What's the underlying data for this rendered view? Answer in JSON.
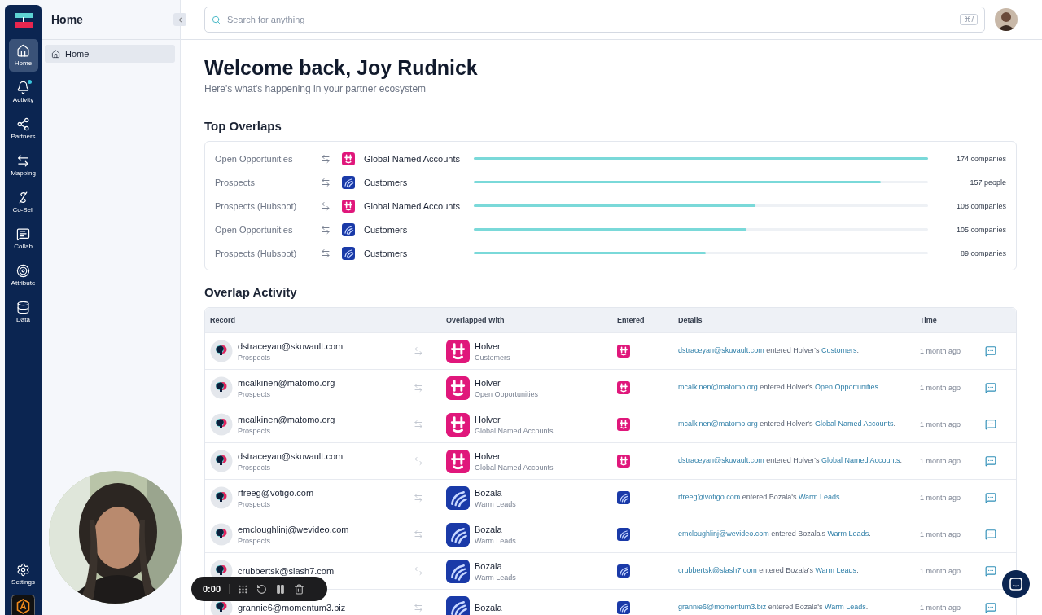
{
  "rail": {
    "items": [
      {
        "label": "Home",
        "kind": "home",
        "selected": true,
        "unread": false
      },
      {
        "label": "Activity",
        "kind": "bell",
        "selected": false,
        "unread": true
      },
      {
        "label": "Partners",
        "kind": "partners",
        "selected": false,
        "unread": false
      },
      {
        "label": "Mapping",
        "kind": "mapping",
        "selected": false,
        "unread": false
      },
      {
        "label": "Co-Sell",
        "kind": "cosell",
        "selected": false,
        "unread": false
      },
      {
        "label": "Collab",
        "kind": "collab",
        "selected": false,
        "unread": false
      },
      {
        "label": "Attribute",
        "kind": "attribute",
        "selected": false,
        "unread": false
      },
      {
        "label": "Data",
        "kind": "data",
        "selected": false,
        "unread": false
      }
    ],
    "bottom": {
      "label": "Settings"
    }
  },
  "sidebar": {
    "title": "Home",
    "items": [
      {
        "label": "Home",
        "selected": true
      }
    ]
  },
  "search": {
    "placeholder": "Search for anything",
    "shortcut": "⌘/"
  },
  "welcome": {
    "title": "Welcome back, Joy Rudnick",
    "subtitle": "Here's what's happening in your partner ecosystem"
  },
  "top_overlaps": {
    "title": "Top Overlaps",
    "rows": [
      {
        "source": "Open Opportunities",
        "kind": "holver",
        "target": "Global Named Accounts",
        "level": 1.0,
        "count": "174 companies"
      },
      {
        "source": "Prospects",
        "kind": "bozala",
        "target": "Customers",
        "level": 0.896,
        "count": "157 people"
      },
      {
        "source": "Prospects (Hubspot)",
        "kind": "holver",
        "target": "Global Named Accounts",
        "level": 0.62,
        "count": "108 companies"
      },
      {
        "source": "Open Opportunities",
        "kind": "bozala",
        "target": "Customers",
        "level": 0.6,
        "count": "105 companies"
      },
      {
        "source": "Prospects (Hubspot)",
        "kind": "bozala",
        "target": "Customers",
        "level": 0.51,
        "count": "89 companies"
      }
    ]
  },
  "overlap_activity": {
    "title": "Overlap Activity",
    "columns": [
      "Record",
      "Overlapped With",
      "Entered",
      "Details",
      "Time"
    ],
    "rows": [
      {
        "record": "dstraceyan@skuvault.com",
        "record_list": "Prospects",
        "kind": "holver",
        "partner": "Holver",
        "partner_list": "Customers",
        "details": {
          "who": "dstraceyan@skuvault.com",
          "middle": " entered Holver's ",
          "list": "Customers",
          "tail": "."
        },
        "time": "1 month ago"
      },
      {
        "record": "mcalkinen@matomo.org",
        "record_list": "Prospects",
        "kind": "holver",
        "partner": "Holver",
        "partner_list": "Open Opportunities",
        "details": {
          "who": "mcalkinen@matomo.org",
          "middle": " entered Holver's ",
          "list": "Open Opportunities",
          "tail": "."
        },
        "time": "1 month ago"
      },
      {
        "record": "mcalkinen@matomo.org",
        "record_list": "Prospects",
        "kind": "holver",
        "partner": "Holver",
        "partner_list": "Global Named Accounts",
        "details": {
          "who": "mcalkinen@matomo.org",
          "middle": " entered Holver's ",
          "list": "Global Named Accounts",
          "tail": "."
        },
        "time": "1 month ago"
      },
      {
        "record": "dstraceyan@skuvault.com",
        "record_list": "Prospects",
        "kind": "holver",
        "partner": "Holver",
        "partner_list": "Global Named Accounts",
        "details": {
          "who": "dstraceyan@skuvault.com",
          "middle": " entered Holver's ",
          "list": "Global Named Accounts",
          "tail": "."
        },
        "time": "1 month ago"
      },
      {
        "record": "rfreeg@votigo.com",
        "record_list": "Prospects",
        "kind": "bozala",
        "partner": "Bozala",
        "partner_list": "Warm Leads",
        "details": {
          "who": "rfreeg@votigo.com",
          "middle": " entered Bozala's ",
          "list": "Warm Leads",
          "tail": "."
        },
        "time": "1 month ago"
      },
      {
        "record": "emcloughlinj@wevideo.com",
        "record_list": "Prospects",
        "kind": "bozala",
        "partner": "Bozala",
        "partner_list": "Warm Leads",
        "details": {
          "who": "emcloughlinj@wevideo.com",
          "middle": " entered Bozala's ",
          "list": "Warm Leads",
          "tail": "."
        },
        "time": "1 month ago"
      },
      {
        "record": "crubbertsk@slash7.com",
        "kind": "bozala",
        "partner": "Bozala",
        "partner_list": "Warm Leads",
        "details": {
          "who": "crubbertsk@slash7.com",
          "middle": " entered Bozala's ",
          "list": "Warm Leads",
          "tail": "."
        },
        "time": "1 month ago"
      },
      {
        "record": "grannie6@momentum3.biz",
        "kind": "bozala",
        "partner": "Bozala",
        "details": {
          "who": "grannie6@momentum3.biz",
          "middle": " entered Bozala's ",
          "list": "Warm Leads",
          "tail": "."
        },
        "time": "1 month ago"
      }
    ]
  },
  "recorder": {
    "time": "0:00"
  }
}
